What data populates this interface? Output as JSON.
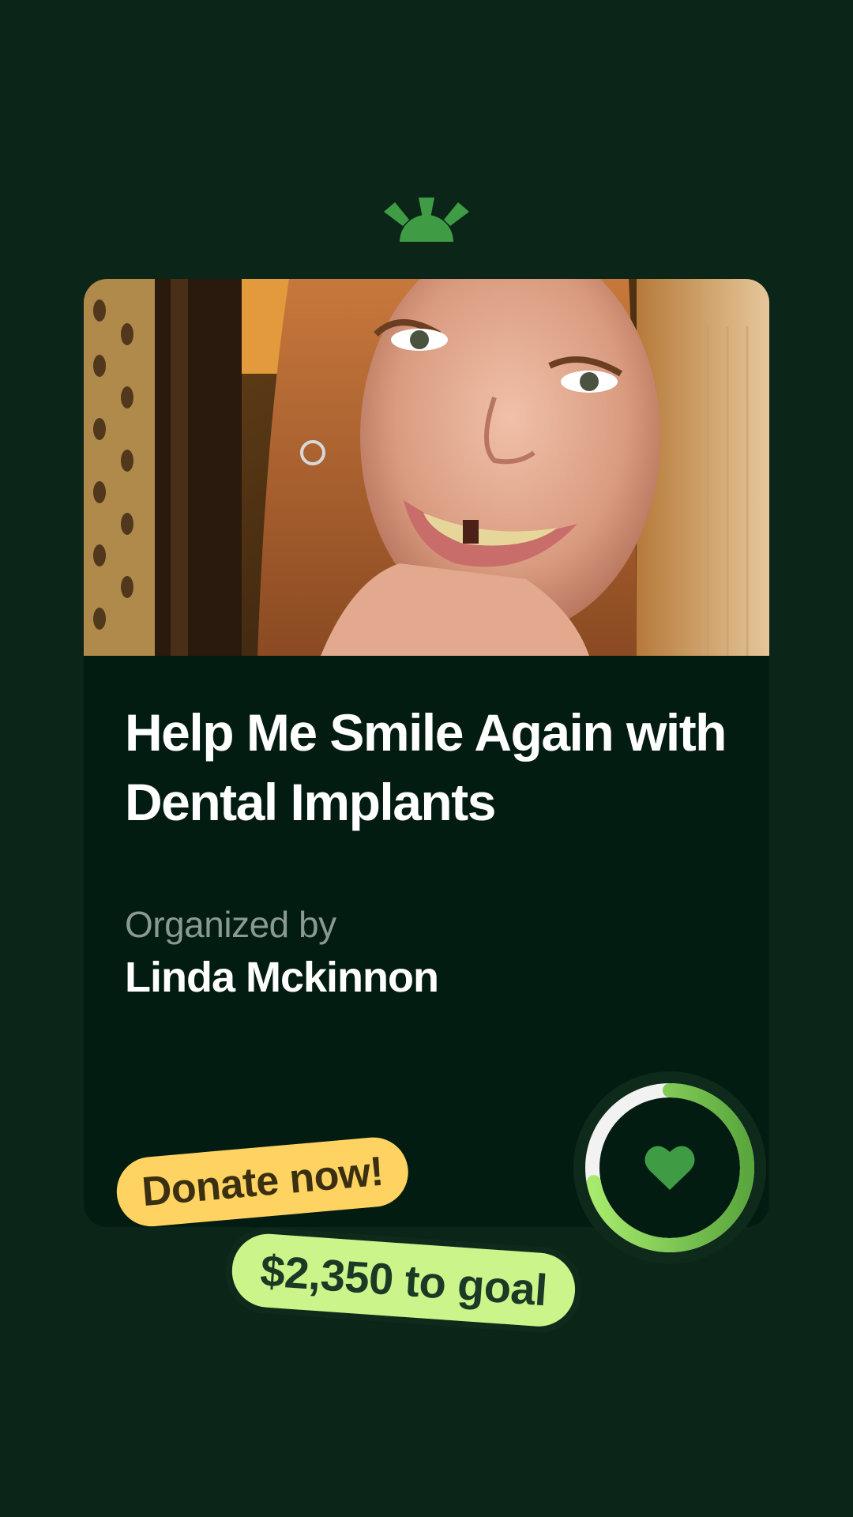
{
  "brand": {
    "logo_icon": "sunrise-logo-icon",
    "accent_color": "#3f9c45",
    "background_color": "#0b2519",
    "card_color": "#021c11"
  },
  "campaign": {
    "photo_icon": "campaign-photo",
    "title": "Help Me Smile Again with Dental Implants",
    "organized_label": "Organized by",
    "organizer_name": "Linda Mckinnon"
  },
  "progress": {
    "icon": "heart-icon",
    "fraction_raised": 0.72,
    "ring_colors": [
      "#5aa73e",
      "#a7eb6d"
    ]
  },
  "cta": {
    "donate_label": "Donate now!",
    "goal_label": "$2,350 to goal",
    "donate_color": "#ffd361",
    "goal_color": "#cbf58b"
  }
}
